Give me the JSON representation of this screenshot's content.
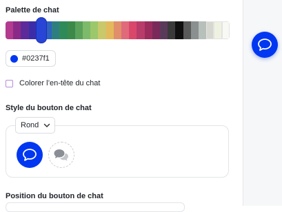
{
  "palette": {
    "heading": "Palette de chat",
    "swatches": [
      "#b23a8f",
      "#8a2a88",
      "#5d2a9a",
      "#3b2da8",
      "#2b44b8",
      "#2e63be",
      "#2d7f7f",
      "#2f8a5a",
      "#3c8a4a",
      "#5aa25a",
      "#7dbb6a",
      "#9bc86a",
      "#c9c86a",
      "#e3b95c",
      "#e08f6a",
      "#e06a7a",
      "#d9486a",
      "#b83c6a",
      "#9a2d5d",
      "#7a2a5a",
      "#5a3a5a",
      "#3a3a3a",
      "#101010",
      "#5a5a5a",
      "#8a8f8f",
      "#b8c0bc",
      "#d6d8cf",
      "#eef2e0",
      "#f8f8f4"
    ],
    "selected_index": 4
  },
  "color": {
    "hex": "#0237f1"
  },
  "header_color": {
    "label": "Colorer l’en-tête du chat",
    "checked": false
  },
  "button_style": {
    "heading": "Style du bouton de chat",
    "shape_value": "Rond",
    "options": [
      {
        "name": "single-bubble",
        "selected": true
      },
      {
        "name": "double-bubble",
        "selected": false
      }
    ]
  },
  "position": {
    "heading": "Position du bouton de chat"
  },
  "accent_color": "#0237f1"
}
